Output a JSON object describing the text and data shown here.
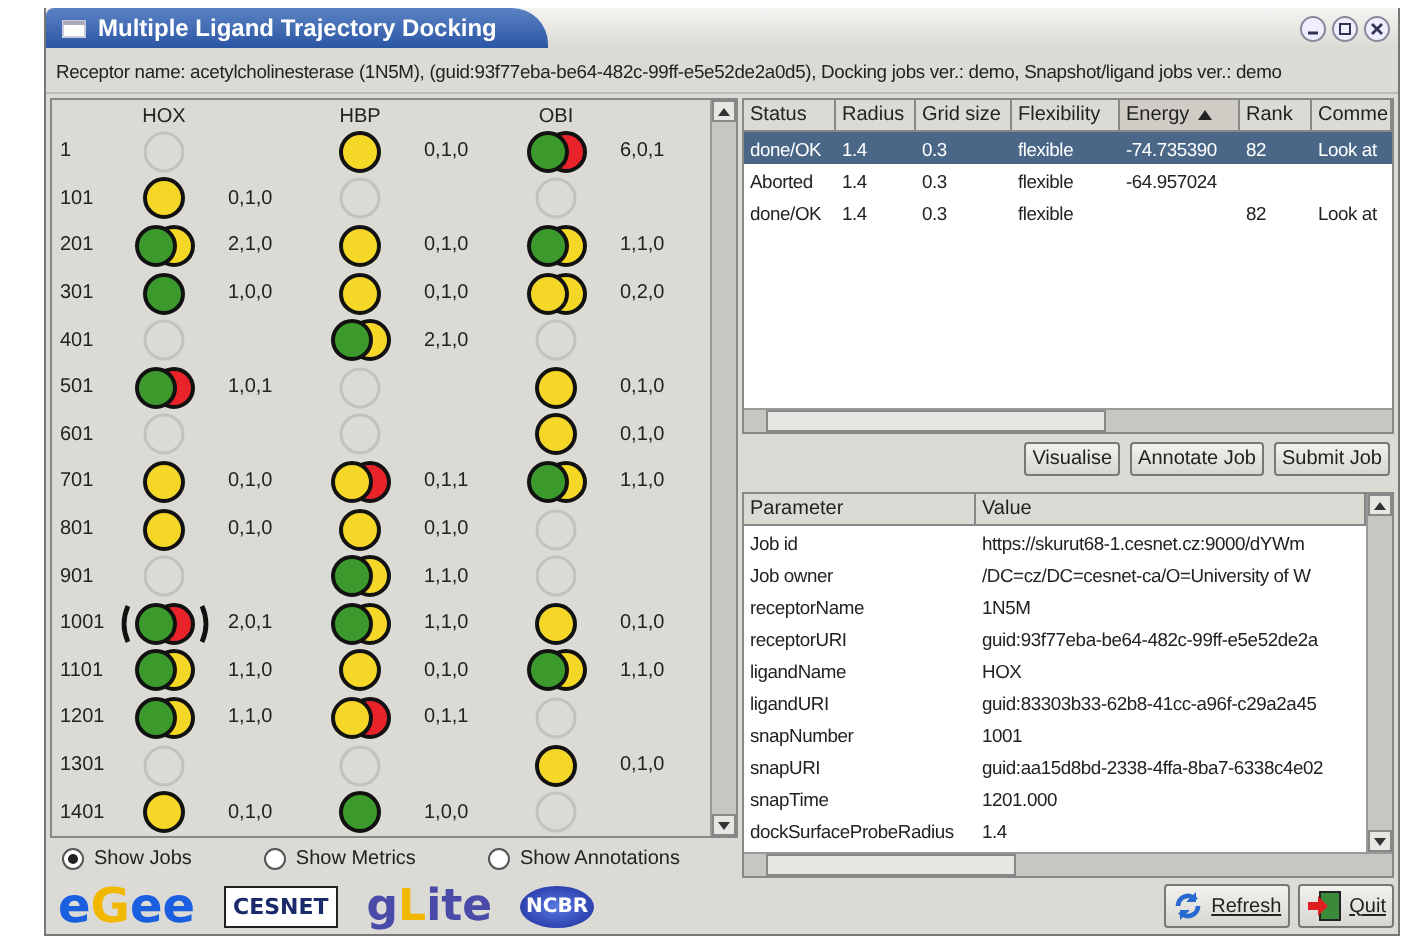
{
  "window": {
    "title": "Multiple Ligand Trajectory Docking"
  },
  "receptor_line": "Receptor name: acetylcholinesterase (1N5M), (guid:93f77eba-be64-482c-99ff-e5e52de2a0d5), Docking jobs ver.: demo, Snapshot/ligand jobs ver.: demo",
  "grid": {
    "columns": [
      "HOX",
      "HBP",
      "OBI"
    ],
    "rows": [
      {
        "snapshot": "1",
        "cells": [
          {
            "kind": "empty"
          },
          {
            "kind": "lit",
            "lights": [
              {
                "color": "#f5d728"
              }
            ],
            "counts": "0,1,0"
          },
          {
            "kind": "lit",
            "lights": [
              {
                "color": "#3c9a2c"
              },
              {
                "color": "#e8242a"
              }
            ],
            "counts": "6,0,1"
          }
        ]
      },
      {
        "snapshot": "101",
        "cells": [
          {
            "kind": "lit",
            "lights": [
              {
                "color": "#f5d728"
              }
            ],
            "counts": "0,1,0"
          },
          {
            "kind": "empty"
          },
          {
            "kind": "empty"
          }
        ]
      },
      {
        "snapshot": "201",
        "cells": [
          {
            "kind": "lit",
            "lights": [
              {
                "color": "#3c9a2c"
              },
              {
                "color": "#f5d728"
              }
            ],
            "counts": "2,1,0"
          },
          {
            "kind": "lit",
            "lights": [
              {
                "color": "#f5d728"
              }
            ],
            "counts": "0,1,0"
          },
          {
            "kind": "lit",
            "lights": [
              {
                "color": "#3c9a2c"
              },
              {
                "color": "#f5d728"
              }
            ],
            "counts": "1,1,0"
          }
        ]
      },
      {
        "snapshot": "301",
        "cells": [
          {
            "kind": "lit",
            "lights": [
              {
                "color": "#3c9a2c"
              }
            ],
            "counts": "1,0,0"
          },
          {
            "kind": "lit",
            "lights": [
              {
                "color": "#f5d728"
              }
            ],
            "counts": "0,1,0"
          },
          {
            "kind": "lit",
            "lights": [
              {
                "color": "#f5d728"
              },
              {
                "color": "#f5d728"
              }
            ],
            "counts": "0,2,0"
          }
        ]
      },
      {
        "snapshot": "401",
        "cells": [
          {
            "kind": "empty"
          },
          {
            "kind": "lit",
            "lights": [
              {
                "color": "#3c9a2c"
              },
              {
                "color": "#f5d728"
              }
            ],
            "counts": "2,1,0"
          },
          {
            "kind": "empty"
          }
        ]
      },
      {
        "snapshot": "501",
        "cells": [
          {
            "kind": "lit",
            "lights": [
              {
                "color": "#3c9a2c"
              },
              {
                "color": "#e8242a"
              }
            ],
            "counts": "1,0,1"
          },
          {
            "kind": "empty"
          },
          {
            "kind": "lit",
            "lights": [
              {
                "color": "#f5d728"
              }
            ],
            "counts": "0,1,0"
          }
        ]
      },
      {
        "snapshot": "601",
        "cells": [
          {
            "kind": "empty"
          },
          {
            "kind": "empty"
          },
          {
            "kind": "lit",
            "lights": [
              {
                "color": "#f5d728"
              }
            ],
            "counts": "0,1,0"
          }
        ]
      },
      {
        "snapshot": "701",
        "cells": [
          {
            "kind": "lit",
            "lights": [
              {
                "color": "#f5d728"
              }
            ],
            "counts": "0,1,0"
          },
          {
            "kind": "lit",
            "lights": [
              {
                "color": "#f5d728"
              },
              {
                "color": "#e8242a"
              }
            ],
            "counts": "0,1,1"
          },
          {
            "kind": "lit",
            "lights": [
              {
                "color": "#3c9a2c"
              },
              {
                "color": "#f5d728"
              }
            ],
            "counts": "1,1,0"
          }
        ]
      },
      {
        "snapshot": "801",
        "cells": [
          {
            "kind": "lit",
            "lights": [
              {
                "color": "#f5d728"
              }
            ],
            "counts": "0,1,0"
          },
          {
            "kind": "lit",
            "lights": [
              {
                "color": "#f5d728"
              }
            ],
            "counts": "0,1,0"
          },
          {
            "kind": "empty"
          }
        ]
      },
      {
        "snapshot": "901",
        "cells": [
          {
            "kind": "empty"
          },
          {
            "kind": "lit",
            "lights": [
              {
                "color": "#3c9a2c"
              },
              {
                "color": "#f5d728"
              }
            ],
            "counts": "1,1,0"
          },
          {
            "kind": "empty"
          }
        ]
      },
      {
        "snapshot": "1001",
        "cells": [
          {
            "kind": "lit",
            "lights": [
              {
                "color": "#3c9a2c"
              },
              {
                "color": "#e8242a"
              }
            ],
            "counts": "2,0,1",
            "selected": true
          },
          {
            "kind": "lit",
            "lights": [
              {
                "color": "#3c9a2c"
              },
              {
                "color": "#f5d728"
              }
            ],
            "counts": "1,1,0",
            "selected": false
          },
          {
            "kind": "lit",
            "lights": [
              {
                "color": "#f5d728"
              }
            ],
            "counts": "0,1,0",
            "selected": false
          }
        ]
      },
      {
        "snapshot": "1101",
        "cells": [
          {
            "kind": "lit",
            "lights": [
              {
                "color": "#3c9a2c"
              },
              {
                "color": "#f5d728"
              }
            ],
            "counts": "1,1,0"
          },
          {
            "kind": "lit",
            "lights": [
              {
                "color": "#f5d728"
              }
            ],
            "counts": "0,1,0"
          },
          {
            "kind": "lit",
            "lights": [
              {
                "color": "#3c9a2c"
              },
              {
                "color": "#f5d728"
              }
            ],
            "counts": "1,1,0"
          }
        ]
      },
      {
        "snapshot": "1201",
        "cells": [
          {
            "kind": "lit",
            "lights": [
              {
                "color": "#3c9a2c"
              },
              {
                "color": "#f5d728"
              }
            ],
            "counts": "1,1,0"
          },
          {
            "kind": "lit",
            "lights": [
              {
                "color": "#f5d728"
              },
              {
                "color": "#e8242a"
              }
            ],
            "counts": "0,1,1"
          },
          {
            "kind": "empty"
          }
        ]
      },
      {
        "snapshot": "1301",
        "cells": [
          {
            "kind": "empty"
          },
          {
            "kind": "empty"
          },
          {
            "kind": "lit",
            "lights": [
              {
                "color": "#f5d728"
              }
            ],
            "counts": "0,1,0"
          }
        ]
      },
      {
        "snapshot": "1401",
        "cells": [
          {
            "kind": "lit",
            "lights": [
              {
                "color": "#f5d728"
              }
            ],
            "counts": "0,1,0"
          },
          {
            "kind": "lit",
            "lights": [
              {
                "color": "#3c9a2c"
              }
            ],
            "counts": "1,0,0"
          },
          {
            "kind": "empty"
          }
        ]
      }
    ]
  },
  "view_options": [
    {
      "label": "Show Jobs",
      "selected": true
    },
    {
      "label": "Show Metrics",
      "selected": false
    },
    {
      "label": "Show Annotations",
      "selected": false
    }
  ],
  "jobs_table": {
    "columns": [
      {
        "label": "Status",
        "sorted": false
      },
      {
        "label": "Radius",
        "sorted": false
      },
      {
        "label": "Grid size",
        "sorted": false
      },
      {
        "label": "Flexibility",
        "sorted": false
      },
      {
        "label": "Energy",
        "sorted": true
      },
      {
        "label": "Rank",
        "sorted": false
      },
      {
        "label": "Comme",
        "sorted": false
      }
    ],
    "rows": [
      {
        "selected": true,
        "cells": [
          "done/OK",
          "1.4",
          "0.3",
          "flexible",
          "-74.735390",
          "82",
          "Look at"
        ]
      },
      {
        "selected": false,
        "cells": [
          "Aborted",
          "1.4",
          "0.3",
          "flexible",
          "-64.957024",
          "",
          ""
        ]
      },
      {
        "selected": false,
        "cells": [
          "done/OK",
          "1.4",
          "0.3",
          "flexible",
          "",
          "82",
          "Look at"
        ]
      }
    ]
  },
  "job_buttons": [
    "Visualise",
    "Annotate Job",
    "Submit Job"
  ],
  "params_table": {
    "columns": [
      "Parameter",
      "Value"
    ],
    "rows": [
      [
        "Job id",
        "https://skurut68-1.cesnet.cz:9000/dYWm"
      ],
      [
        "Job owner",
        "/DC=cz/DC=cesnet-ca/O=University of W"
      ],
      [
        "receptorName",
        "1N5M"
      ],
      [
        "receptorURI",
        "guid:93f77eba-be64-482c-99ff-e5e52de2a"
      ],
      [
        "ligandName",
        "HOX"
      ],
      [
        "ligandURI",
        "guid:83303b33-62b8-41cc-a96f-c29a2a45"
      ],
      [
        "snapNumber",
        "1001"
      ],
      [
        "snapURI",
        "guid:aa15d8bd-2338-4ffa-8ba7-6338c4e02"
      ],
      [
        "snapTime",
        "1201.000"
      ],
      [
        "dockSurfaceProbeRadius",
        "1.4"
      ]
    ]
  },
  "logos": [
    {
      "kind": "egee",
      "parts": [
        {
          "text": "e",
          "accent": false
        },
        {
          "text": "G",
          "accent": true
        },
        {
          "text": "ee",
          "accent": false
        }
      ]
    },
    {
      "kind": "cesnet",
      "text": "CESNET"
    },
    {
      "kind": "glite",
      "parts": [
        {
          "text": "g",
          "accent": false
        },
        {
          "text": "L",
          "accent": true
        },
        {
          "text": "ite",
          "accent": false
        }
      ]
    },
    {
      "kind": "ncbr",
      "text": "NCBR"
    }
  ],
  "bottom_buttons": [
    {
      "label": "Refresh",
      "kind": "refresh"
    },
    {
      "label": "Quit",
      "kind": "quit"
    }
  ]
}
